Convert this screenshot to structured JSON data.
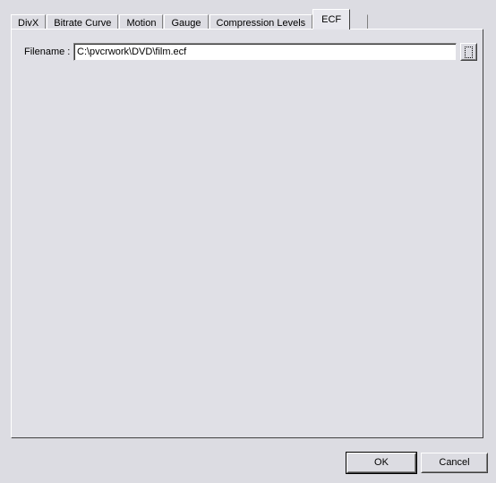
{
  "dialog": {
    "tabs": [
      {
        "id": "divx",
        "label": "DivX",
        "active": false
      },
      {
        "id": "bitrate-curve",
        "label": "Bitrate Curve",
        "active": false
      },
      {
        "id": "motion",
        "label": "Motion",
        "active": false
      },
      {
        "id": "gauge",
        "label": "Gauge",
        "active": false
      },
      {
        "id": "compression-levels",
        "label": "Compression Levels",
        "active": false
      },
      {
        "id": "ecf",
        "label": "ECF",
        "active": true
      }
    ],
    "panel": {
      "filename": {
        "label": "Filename :",
        "value": "C:\\pvcrwork\\DVD\\film.ecf",
        "placeholder": "",
        "browse_icon": "browse-ellipsis-icon"
      }
    },
    "footer": {
      "ok_label": "OK",
      "cancel_label": "Cancel"
    },
    "colors": {
      "window_background": "#dcdce2",
      "panel_background": "#e0e0e6",
      "field_background": "#ffffff",
      "text": "#000000",
      "shadow": "#404040",
      "highlight": "#ffffff",
      "border": "#808080"
    }
  }
}
